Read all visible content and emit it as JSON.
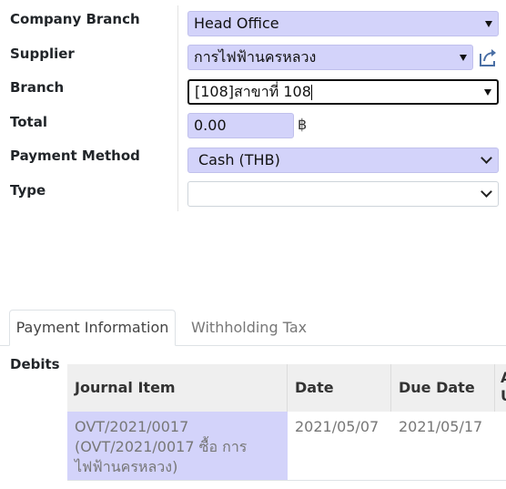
{
  "form": {
    "company_branch_label": "Company Branch",
    "company_branch_value": "Head Office",
    "supplier_label": "Supplier",
    "supplier_value": "การไฟฟ้านครหลวง",
    "branch_label": "Branch",
    "branch_value": "[108]สาขาที่ 108",
    "total_label": "Total",
    "total_value": "0.00",
    "currency_symbol": "฿",
    "payment_method_label": "Payment Method",
    "payment_method_value": "Cash (THB)",
    "type_label": "Type",
    "type_value": ""
  },
  "tabs": [
    {
      "label": "Payment Information",
      "active": true
    },
    {
      "label": "Withholding Tax",
      "active": false
    }
  ],
  "debits": {
    "label": "Debits",
    "columns": [
      "Journal Item",
      "Date",
      "Due Date",
      "A",
      "U"
    ],
    "rows": [
      {
        "journal_item": "OVT/2021/0017 (OVT/2021/0017 ซื้อ การไฟฟ้านครหลวง)",
        "date": "2021/05/07",
        "due_date": "2021/05/17"
      }
    ]
  },
  "colors": {
    "field_bg": "#d3d3fa",
    "header_bg": "#efefef"
  }
}
